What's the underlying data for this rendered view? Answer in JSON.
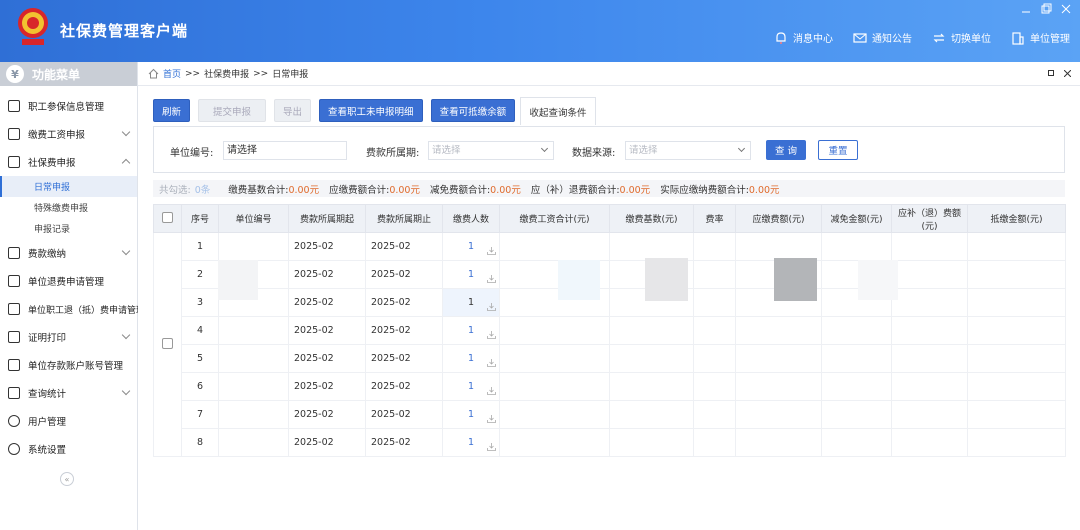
{
  "app": {
    "title": "社保费管理客户端"
  },
  "topnav": [
    {
      "label": "消息中心",
      "icon": "bell-icon"
    },
    {
      "label": "通知公告",
      "icon": "mail-icon"
    },
    {
      "label": "切换单位",
      "icon": "switch-icon"
    },
    {
      "label": "单位管理",
      "icon": "building-icon"
    }
  ],
  "sidebar": {
    "header": "功能菜单",
    "items": [
      {
        "label": "职工参保信息管理",
        "icon": "list-icon"
      },
      {
        "label": "缴费工资申报",
        "icon": "edit-icon"
      },
      {
        "label": "社保费申报",
        "icon": "list-icon",
        "children": [
          "日常申报",
          "特殊缴费申报",
          "申报记录"
        ]
      },
      {
        "label": "费款缴纳",
        "icon": "card-icon"
      },
      {
        "label": "单位退费申请管理",
        "icon": "list-icon"
      },
      {
        "label": "单位职工退（抵）费申请管理",
        "icon": "list-icon"
      },
      {
        "label": "证明打印",
        "icon": "doc-icon"
      },
      {
        "label": "单位存款账户账号管理",
        "icon": "card-icon"
      },
      {
        "label": "查询统计",
        "icon": "chart-icon"
      },
      {
        "label": "用户管理",
        "icon": "gear-icon"
      },
      {
        "label": "系统设置",
        "icon": "gear-icon"
      }
    ]
  },
  "breadcrumb": {
    "home": "首页",
    "sep": ">>",
    "level1": "社保费申报",
    "level2": "日常申报"
  },
  "toolbar": {
    "refresh": "刷新",
    "submit": "提交申报",
    "export": "导出",
    "unreported": "查看职工未申报明细",
    "deductible": "查看可抵缴余额",
    "collapse": "收起查询条件"
  },
  "filters": {
    "unit_code_label": "单位编号:",
    "unit_code_value": "请选择",
    "period_label": "费款所属期:",
    "period_placeholder": "请选择",
    "source_label": "数据来源:",
    "source_placeholder": "请选择",
    "search": "查 询",
    "reset": "重置"
  },
  "summary": {
    "total_label": "共勾选:",
    "total_value": "0条",
    "base_label": "缴费基数合计:",
    "base_value": "0.00元",
    "due_label": "应缴费额合计:",
    "due_value": "0.00元",
    "exempt_label": "减免费额合计:",
    "exempt_value": "0.00元",
    "refund_label": "应（补）退费额合计:",
    "refund_value": "0.00元",
    "actual_label": "实际应缴纳费额合计:",
    "actual_value": "0.00元"
  },
  "table": {
    "columns": [
      "序号",
      "单位编号",
      "费款所属期起",
      "费款所属期止",
      "缴费人数",
      "缴费工资合计(元)",
      "缴费基数(元)",
      "费率",
      "应缴费额(元)",
      "减免金额(元)",
      "应补（退）费额(元)",
      "抵缴金额(元)"
    ],
    "rows": [
      {
        "no": "1",
        "start": "2025-02",
        "end": "2025-02",
        "count": "1"
      },
      {
        "no": "2",
        "start": "2025-02",
        "end": "2025-02",
        "count": "1"
      },
      {
        "no": "3",
        "start": "2025-02",
        "end": "2025-02",
        "count": "1"
      },
      {
        "no": "4",
        "start": "2025-02",
        "end": "2025-02",
        "count": "1"
      },
      {
        "no": "5",
        "start": "2025-02",
        "end": "2025-02",
        "count": "1"
      },
      {
        "no": "6",
        "start": "2025-02",
        "end": "2025-02",
        "count": "1"
      },
      {
        "no": "7",
        "start": "2025-02",
        "end": "2025-02",
        "count": "1"
      },
      {
        "no": "8",
        "start": "2025-02",
        "end": "2025-02",
        "count": "1"
      }
    ]
  },
  "colors": {
    "titlebar": "#3d86ec",
    "primary": "#3a6fd3",
    "accent_orange": "#e06b2d"
  }
}
